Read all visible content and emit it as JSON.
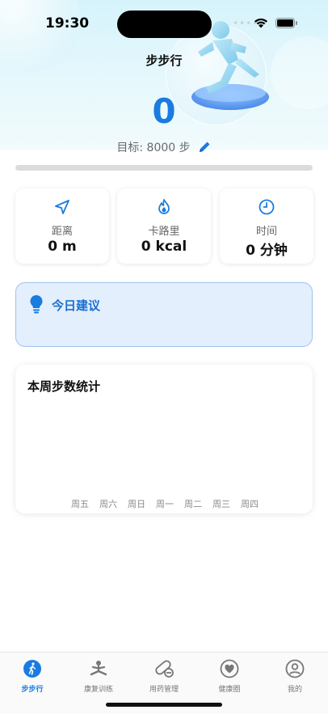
{
  "status_bar": {
    "time": "19:30",
    "signal_dots": "••••"
  },
  "header": {
    "title": "步步行",
    "steps": "0",
    "goal_label": "目标: 8000 步",
    "progress_fraction": 0
  },
  "stats": [
    {
      "icon": "navigation-arrow-icon",
      "label": "距离",
      "value": "0 m"
    },
    {
      "icon": "flame-icon",
      "label": "卡路里",
      "value": "0 kcal"
    },
    {
      "icon": "clock-icon",
      "label": "时间",
      "value": "0 分钟"
    }
  ],
  "advice": {
    "icon": "lightbulb-icon",
    "title": "今日建议"
  },
  "weekly": {
    "title": "本周步数统计",
    "days": [
      "周五",
      "周六",
      "周日",
      "周一",
      "周二",
      "周三",
      "周四"
    ]
  },
  "chart_data": {
    "type": "bar",
    "title": "本周步数统计",
    "categories": [
      "周五",
      "周六",
      "周日",
      "周一",
      "周二",
      "周三",
      "周四"
    ],
    "values": [
      0,
      0,
      0,
      0,
      0,
      0,
      0
    ],
    "xlabel": "",
    "ylabel": "",
    "grid": false
  },
  "tabbar": {
    "items": [
      {
        "label": "步步行",
        "icon": "walking-person-icon",
        "active": true
      },
      {
        "label": "康复训练",
        "icon": "meditation-icon",
        "active": false
      },
      {
        "label": "用药管理",
        "icon": "pill-icon",
        "active": false
      },
      {
        "label": "健康圈",
        "icon": "heart-circle-icon",
        "active": false
      },
      {
        "label": "我的",
        "icon": "user-circle-icon",
        "active": false
      }
    ]
  },
  "colors": {
    "accent": "#1a7be0",
    "advice_bg": "#e3effc",
    "advice_border": "#9fc4ee"
  }
}
